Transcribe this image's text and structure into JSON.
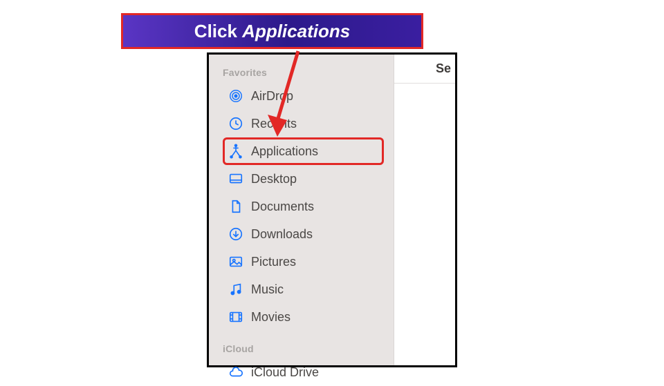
{
  "callout": {
    "prefix": "Click ",
    "emphasis": "Applications"
  },
  "sidebar": {
    "favorites_title": "Favorites",
    "icloud_title": "iCloud",
    "items": [
      {
        "label": "AirDrop"
      },
      {
        "label": "Recents"
      },
      {
        "label": "Applications"
      },
      {
        "label": "Desktop"
      },
      {
        "label": "Documents"
      },
      {
        "label": "Downloads"
      },
      {
        "label": "Pictures"
      },
      {
        "label": "Music"
      },
      {
        "label": "Movies"
      }
    ],
    "icloud_items": [
      {
        "label": "iCloud Drive"
      }
    ]
  },
  "main": {
    "header_fragment": "Se"
  },
  "colors": {
    "accent": "#1874ff",
    "highlight": "#e22826"
  }
}
